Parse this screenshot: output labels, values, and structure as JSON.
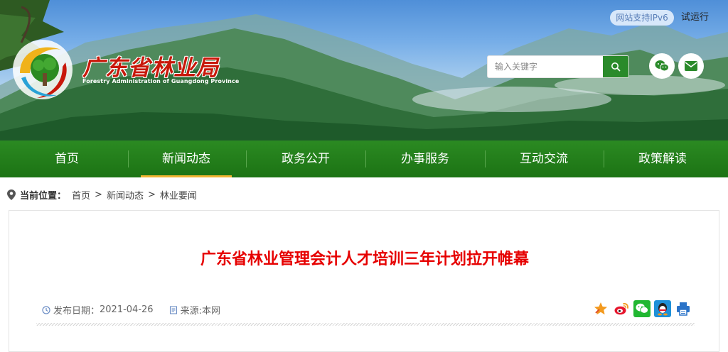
{
  "header": {
    "logo_title": "广东省林业局",
    "logo_subtitle": "Forestry Administration of Guangdong Province",
    "ipv6_badge": "网站支持IPv6",
    "trial_text": "试运行",
    "search_placeholder": "输入关键字",
    "icons": [
      "search-icon",
      "wechat-icon",
      "mail-icon"
    ]
  },
  "nav": {
    "items": [
      {
        "label": "首页"
      },
      {
        "label": "新闻动态",
        "active": true
      },
      {
        "label": "政务公开"
      },
      {
        "label": "办事服务"
      },
      {
        "label": "互动交流"
      },
      {
        "label": "政策解读"
      }
    ]
  },
  "breadcrumb": {
    "label": "当前位置：",
    "items": [
      "首页",
      "新闻动态",
      "林业要闻"
    ],
    "separator": ">"
  },
  "article": {
    "title": "广东省林业管理会计人才培训三年计划拉开帷幕",
    "date_label": "发布日期：",
    "date": "2021-04-26",
    "source_label": "来源:",
    "source": "本网",
    "share_icons": [
      "favorite-star-icon",
      "weibo-icon",
      "wechat-share-icon",
      "qq-icon",
      "print-icon"
    ]
  },
  "colors": {
    "nav_green": "#1f7a17",
    "title_red": "#e60000",
    "active_underline": "#f1b532",
    "search_green": "#2a8a2a"
  }
}
